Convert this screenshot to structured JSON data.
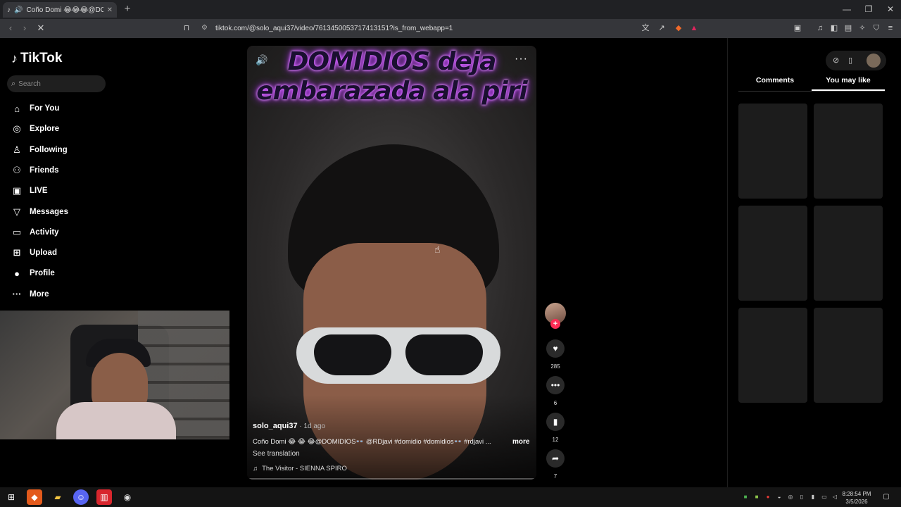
{
  "browser": {
    "tab_title": "Coño Domi 😂😂😂@DOMI",
    "url": "tiktok.com/@solo_aqui37/video/7613450053717413151?is_from_webapp=1",
    "new_tab": "+",
    "win_min": "—",
    "win_max": "❐",
    "win_close": "✕"
  },
  "sidebar": {
    "brand": "TikTok",
    "search_placeholder": "Search",
    "items": [
      {
        "label": "For You",
        "icon": "home-icon",
        "glyph": "⌂"
      },
      {
        "label": "Explore",
        "icon": "compass-icon",
        "glyph": "◎"
      },
      {
        "label": "Following",
        "icon": "person-check-icon",
        "glyph": "♙"
      },
      {
        "label": "Friends",
        "icon": "friends-icon",
        "glyph": "⚇"
      },
      {
        "label": "LIVE",
        "icon": "live-icon",
        "glyph": "▣"
      },
      {
        "label": "Messages",
        "icon": "send-icon",
        "glyph": "▽"
      },
      {
        "label": "Activity",
        "icon": "activity-icon",
        "glyph": "▭"
      },
      {
        "label": "Upload",
        "icon": "upload-icon",
        "glyph": "⊞"
      },
      {
        "label": "Profile",
        "icon": "profile-avatar-icon",
        "glyph": "●"
      },
      {
        "label": "More",
        "icon": "more-dots-icon",
        "glyph": "···"
      }
    ]
  },
  "video": {
    "caption_line1": "DOMIDIOS deja",
    "caption_line2": "embarazada ala piri",
    "author": "solo_aqui37",
    "date": " · 1d ago",
    "description": "Coño Domi 😂 😂 😂@DOMIDIOS👓 @RDjavi #domidio #domidios👓 #rdjavi ...",
    "more_label": "more",
    "translate_label": "See translation",
    "music": "The Visitor - SIENNA SPIRO"
  },
  "actions": {
    "likes": "285",
    "comments": "6",
    "saves": "12",
    "shares": "7"
  },
  "right_panel": {
    "tab_comments": "Comments",
    "tab_you_may_like": "You may like"
  },
  "clock": {
    "time": "8:28:54 PM",
    "date": "3/5/2026"
  }
}
